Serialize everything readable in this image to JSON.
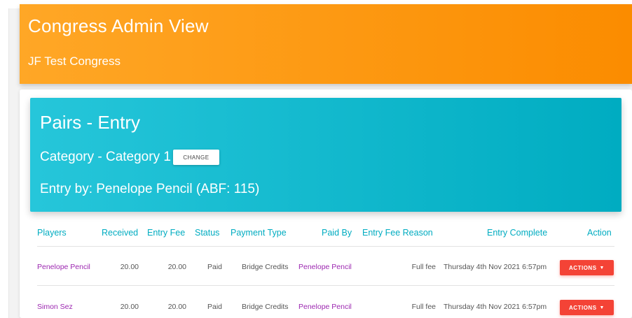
{
  "header": {
    "title": "Congress Admin View",
    "subtitle": "JF Test Congress"
  },
  "entry_card": {
    "title": "Pairs - Entry",
    "category": "Category - Category 1",
    "change_label": "CHANGE",
    "entry_by": "Entry by: Penelope Pencil (ABF: 115)"
  },
  "table": {
    "columns": [
      "Players",
      "Received",
      "Entry Fee",
      "Status",
      "Payment Type",
      "Paid By",
      "Entry Fee Reason",
      "Entry Complete",
      "Action"
    ],
    "rows": [
      {
        "player": "Penelope Pencil",
        "received": "20.00",
        "entry_fee": "20.00",
        "status": "Paid",
        "payment_type": "Bridge Credits",
        "paid_by": "Penelope Pencil",
        "reason": "Full fee",
        "complete": "Thursday 4th Nov 2021 6:57pm",
        "action": "ACTIONS"
      },
      {
        "player": "Simon Sez",
        "received": "20.00",
        "entry_fee": "20.00",
        "status": "Paid",
        "payment_type": "Bridge Credits",
        "paid_by": "Penelope Pencil",
        "reason": "Full fee",
        "complete": "Thursday 4th Nov 2021 6:57pm",
        "action": "ACTIONS"
      }
    ]
  },
  "colors": {
    "header_orange": "#fb8c00",
    "entry_cyan": "#00acc1",
    "link_purple": "#9c27b0",
    "action_red": "#f44336"
  },
  "icons": {
    "actions_caret": "caret-down-icon"
  }
}
